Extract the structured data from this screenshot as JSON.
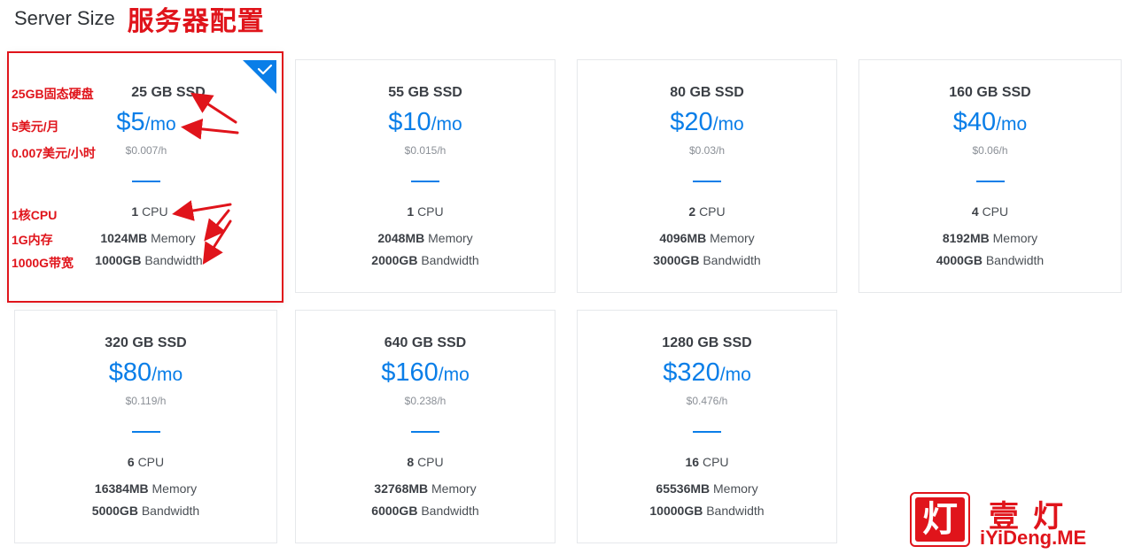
{
  "header": {
    "title": "Server Size",
    "annotation_title": "服务器配置"
  },
  "colors": {
    "accent": "#0a7ee8",
    "annotation": "#e0141b"
  },
  "plans": [
    {
      "ssd": "25 GB SSD",
      "price": "$5",
      "unit": "/mo",
      "hourly": "$0.007/h",
      "cpu_num": "1",
      "cpu_label": "CPU",
      "mem_num": "1024MB",
      "mem_label": "Memory",
      "bw_num": "1000GB",
      "bw_label": "Bandwidth",
      "selected": true
    },
    {
      "ssd": "55 GB SSD",
      "price": "$10",
      "unit": "/mo",
      "hourly": "$0.015/h",
      "cpu_num": "1",
      "cpu_label": "CPU",
      "mem_num": "2048MB",
      "mem_label": "Memory",
      "bw_num": "2000GB",
      "bw_label": "Bandwidth",
      "selected": false
    },
    {
      "ssd": "80 GB SSD",
      "price": "$20",
      "unit": "/mo",
      "hourly": "$0.03/h",
      "cpu_num": "2",
      "cpu_label": "CPU",
      "mem_num": "4096MB",
      "mem_label": "Memory",
      "bw_num": "3000GB",
      "bw_label": "Bandwidth",
      "selected": false
    },
    {
      "ssd": "160 GB SSD",
      "price": "$40",
      "unit": "/mo",
      "hourly": "$0.06/h",
      "cpu_num": "4",
      "cpu_label": "CPU",
      "mem_num": "8192MB",
      "mem_label": "Memory",
      "bw_num": "4000GB",
      "bw_label": "Bandwidth",
      "selected": false
    },
    {
      "ssd": "320 GB SSD",
      "price": "$80",
      "unit": "/mo",
      "hourly": "$0.119/h",
      "cpu_num": "6",
      "cpu_label": "CPU",
      "mem_num": "16384MB",
      "mem_label": "Memory",
      "bw_num": "5000GB",
      "bw_label": "Bandwidth",
      "selected": false
    },
    {
      "ssd": "640 GB SSD",
      "price": "$160",
      "unit": "/mo",
      "hourly": "$0.238/h",
      "cpu_num": "8",
      "cpu_label": "CPU",
      "mem_num": "32768MB",
      "mem_label": "Memory",
      "bw_num": "6000GB",
      "bw_label": "Bandwidth",
      "selected": false
    },
    {
      "ssd": "1280 GB SSD",
      "price": "$320",
      "unit": "/mo",
      "hourly": "$0.476/h",
      "cpu_num": "16",
      "cpu_label": "CPU",
      "mem_num": "65536MB",
      "mem_label": "Memory",
      "bw_num": "10000GB",
      "bw_label": "Bandwidth",
      "selected": false
    }
  ],
  "annotations": {
    "ssd": "25GB固态硬盘",
    "monthly": "5美元/月",
    "hourly": "0.007美元/小时",
    "cpu": "1核CPU",
    "memory": "1G内存",
    "bandwidth": "1000G带宽"
  },
  "watermark": {
    "badge_char": "灯",
    "cn": "壹灯",
    "en": "iYiDeng.ME"
  }
}
